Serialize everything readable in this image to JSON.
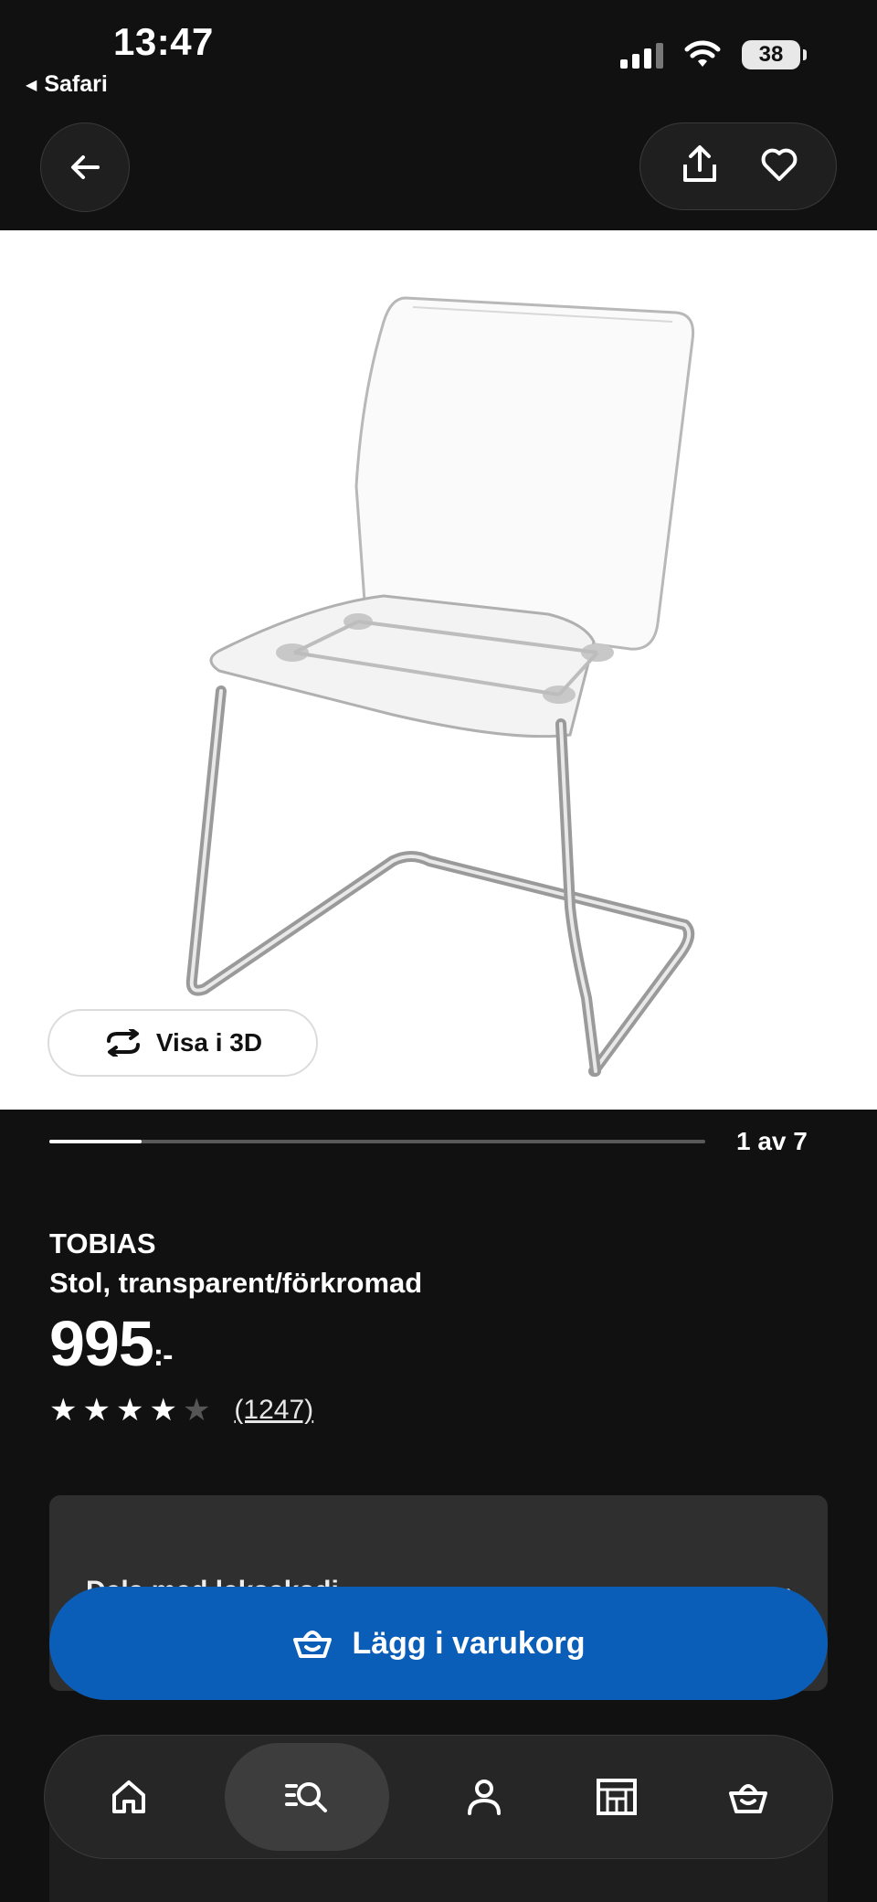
{
  "status_bar": {
    "time": "13:47",
    "back_app": "Safari",
    "battery": "38"
  },
  "nav": {
    "back_icon": "arrow-left-icon",
    "share_icon": "share-icon",
    "favorite_icon": "heart-icon"
  },
  "image": {
    "view_3d_label": "Visa i 3D",
    "counter": "1 av 7",
    "progress_fraction": 0.14
  },
  "product": {
    "brand": "TOBIAS",
    "description": "Stol, transparent/förkromad",
    "price": "995",
    "price_suffix": ":-",
    "rating": 4,
    "rating_max": 5,
    "reviews": "(1247)"
  },
  "card": {
    "text": "Dela med leksaksdj...",
    "chevron_icon": "chevron-right-icon"
  },
  "cart_button": {
    "label": "Lägg i varukorg",
    "icon": "basket-icon"
  },
  "tabbar": {
    "items": [
      {
        "name": "home",
        "icon": "home-icon",
        "active": false
      },
      {
        "name": "search",
        "icon": "search-list-icon",
        "active": true
      },
      {
        "name": "profile",
        "icon": "person-icon",
        "active": false
      },
      {
        "name": "store",
        "icon": "store-icon",
        "active": false
      },
      {
        "name": "cart",
        "icon": "basket-icon",
        "active": false
      }
    ]
  },
  "colors": {
    "background": "#111111",
    "primary_blue": "#0b5eb8",
    "card": "#2f2f2f"
  }
}
